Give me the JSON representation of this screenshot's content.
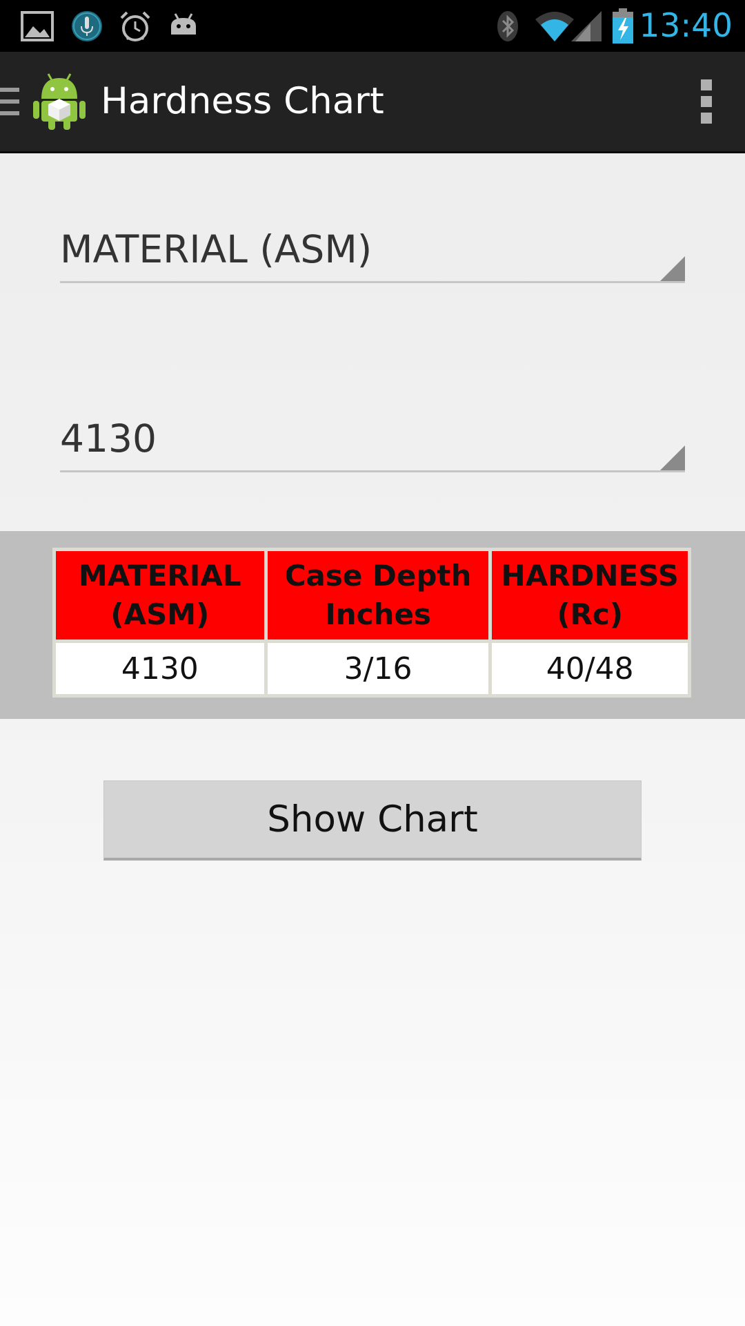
{
  "status_bar": {
    "time": "13:40",
    "left_icons": [
      "gallery-icon",
      "voice-search-icon",
      "alarm-clock-icon",
      "android-notification-icon"
    ],
    "right_icons": [
      "bluetooth-icon",
      "wifi-icon",
      "cell-signal-icon",
      "battery-charging-icon"
    ],
    "time_color": "#33b5e5"
  },
  "action_bar": {
    "title": "Hardness Chart",
    "left_icons": [
      "drawer-menu-icon",
      "app-android-icon"
    ],
    "right_icons": [
      "overflow-menu-icon"
    ]
  },
  "spinners": {
    "category": {
      "value": "MATERIAL (ASM)"
    },
    "material": {
      "value": "4130"
    }
  },
  "table": {
    "headers": [
      {
        "line1": "MATERIAL",
        "line2": "(ASM)"
      },
      {
        "line1": "Case Depth",
        "line2": "Inches"
      },
      {
        "line1": "HARDNESS",
        "line2": "(Rc)"
      }
    ],
    "rows": [
      [
        "4130",
        "3/16",
        "40/48"
      ]
    ],
    "header_color": "#ff0000"
  },
  "button": {
    "label": "Show Chart"
  }
}
